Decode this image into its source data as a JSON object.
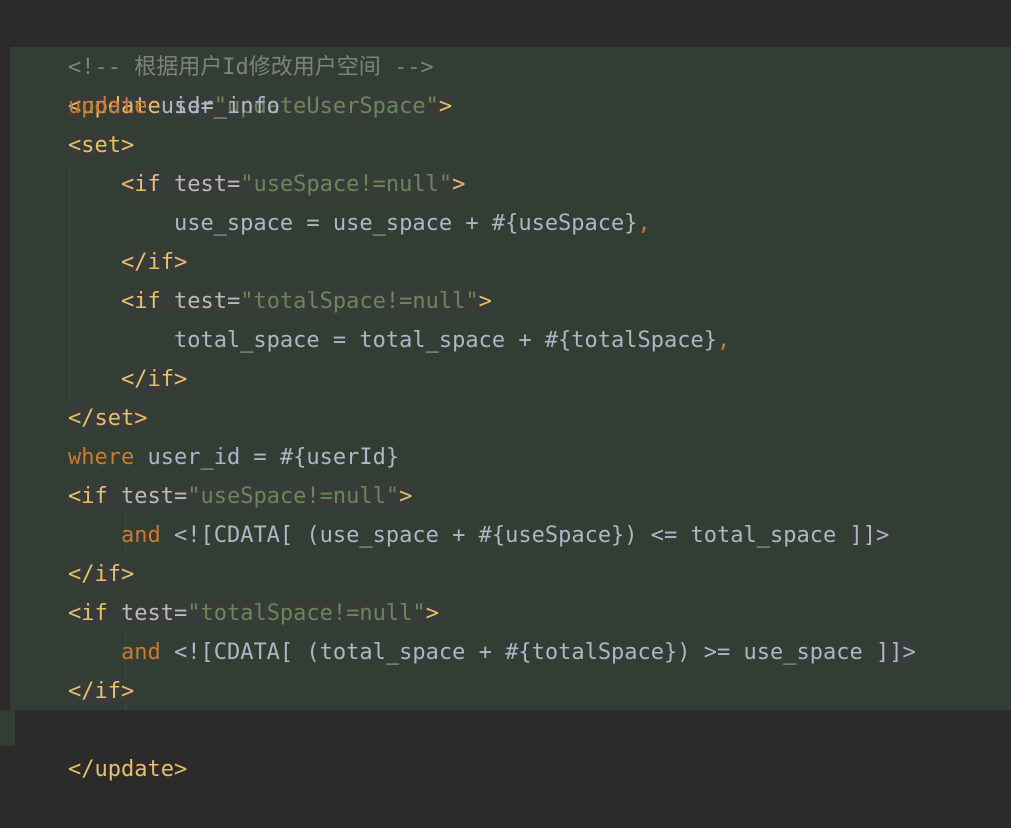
{
  "editor": {
    "comment": "<!-- 根据用户Id修改用户空间 -->",
    "update_open": "<update",
    "update_id_attr": "id",
    "update_id_eq": "=",
    "update_id_value": "\"updateUserSpace\"",
    "tag_close": ">",
    "kw_update": "update",
    "table_name": "user_info",
    "set_open": "<set>",
    "if_open": "<if",
    "test_attr": "test",
    "eq": "=",
    "test_use_space": "\"useSpace!=null\"",
    "test_total_space": "\"totalSpace!=null\"",
    "use_space_assign": "use_space = use_space + #{useSpace}",
    "total_space_assign": "total_space = total_space + #{totalSpace}",
    "comma": ",",
    "if_close": "</if>",
    "set_close": "</set>",
    "kw_where": "where",
    "where_clause": "user_id = #{userId}",
    "kw_and": "and",
    "cdata_use_space": "<![CDATA[ (use_space + #{useSpace}) <= total_space ",
    "cdata_total_space": "<![CDATA[ (total_space + #{totalSpace}) >= use_space ",
    "cdata_end": "]]>",
    "update_close": "</update>"
  }
}
